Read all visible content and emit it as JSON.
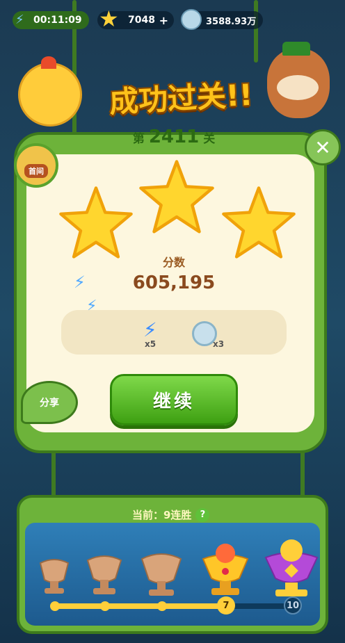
{
  "top_bar": {
    "timer": "00:11:09",
    "stars": "7048",
    "coins": "3588.93万",
    "plus": "+"
  },
  "title": "成功过关!!",
  "level": {
    "prefix": "第",
    "number": "2411",
    "suffix": "关"
  },
  "home_label": "首间",
  "close_symbol": "✕",
  "stars_earned": 3,
  "score": {
    "label": "分数",
    "value": "605,195"
  },
  "rewards": [
    {
      "icon": "lightning-icon",
      "count": "x5"
    },
    {
      "icon": "coin-icon",
      "count": "x3"
    }
  ],
  "continue_label": "继续",
  "share_label": "分享",
  "streak": {
    "text": "当前：9连胜",
    "help": "?",
    "current": 9,
    "milestones": [
      "7",
      "10"
    ]
  },
  "colors": {
    "accent_green": "#6db33a",
    "gold": "#ffc21a",
    "panel": "#fdf7df"
  }
}
